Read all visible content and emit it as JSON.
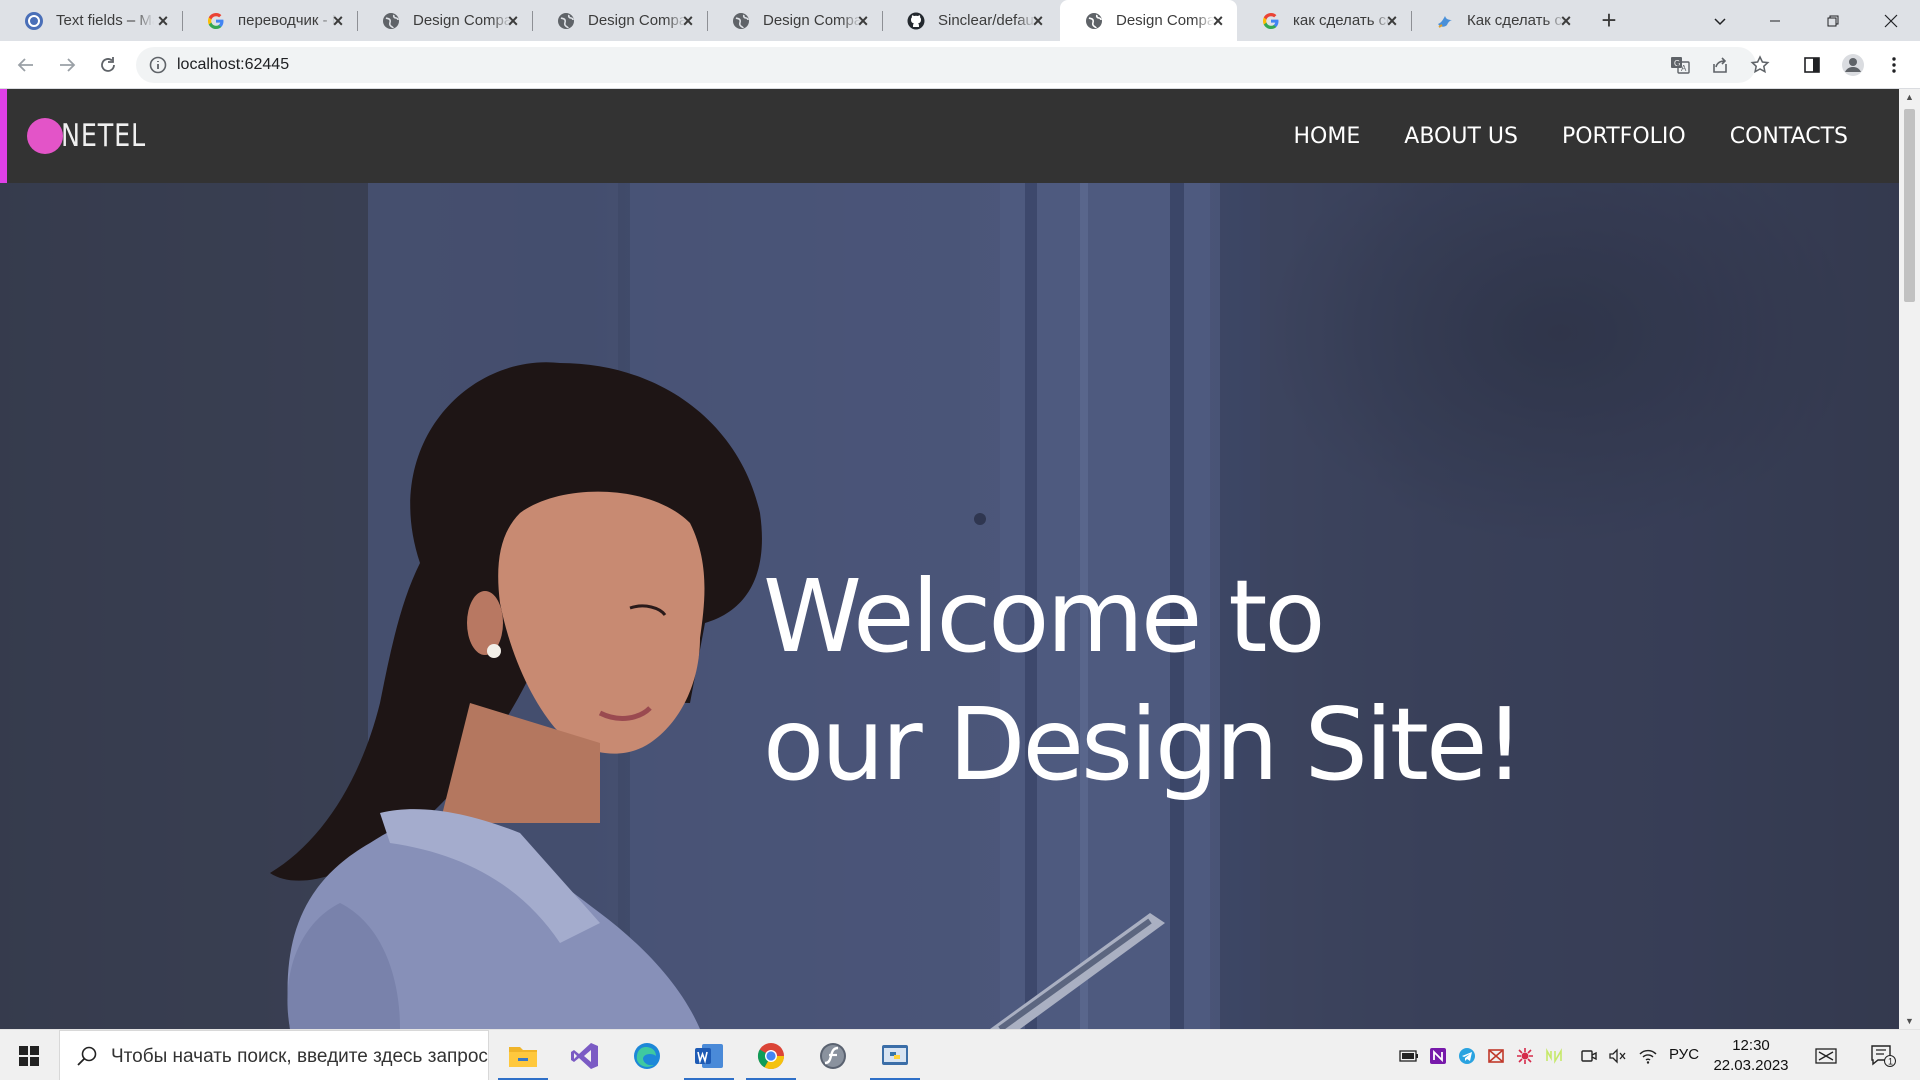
{
  "browser": {
    "tabs": [
      {
        "title": "Text fields – Material",
        "icon": "material-icon",
        "active": false
      },
      {
        "title": "переводчик - Поиск",
        "icon": "google-icon",
        "active": false
      },
      {
        "title": "Design Company",
        "icon": "globe-icon",
        "active": false
      },
      {
        "title": "Design Company",
        "icon": "globe-icon",
        "active": false
      },
      {
        "title": "Design Company",
        "icon": "globe-icon",
        "active": false
      },
      {
        "title": "Sinclear/default",
        "icon": "github-icon",
        "active": false
      },
      {
        "title": "Design Company",
        "icon": "globe-icon",
        "active": true
      },
      {
        "title": "как сделать ссылку",
        "icon": "google-icon",
        "active": false
      },
      {
        "title": "Как сделать ссылку",
        "icon": "bird-icon",
        "active": false
      }
    ],
    "address": "localhost:62445"
  },
  "site": {
    "accent_color": "#e040e8",
    "logo_dot_color": "#e354c8",
    "logo_text": "NETEL",
    "nav": [
      "HOME",
      "ABOUT US",
      "PORTFOLIO",
      "CONTACTS"
    ],
    "hero_line1": "Welcome to",
    "hero_line2": "our Design Site!"
  },
  "taskbar": {
    "search_placeholder": "Чтобы начать поиск, введите здесь запрос",
    "language": "РУС",
    "time": "12:30",
    "date": "22.03.2023",
    "notification_count": "1"
  }
}
